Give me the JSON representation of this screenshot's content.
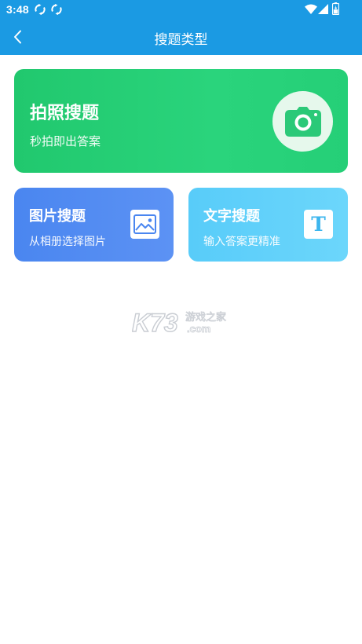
{
  "status_bar": {
    "time": "3:48"
  },
  "header": {
    "title": "搜题类型"
  },
  "cards": {
    "photo": {
      "title": "拍照搜题",
      "subtitle": "秒拍即出答案"
    },
    "image": {
      "title": "图片搜题",
      "subtitle": "从相册选择图片"
    },
    "text": {
      "title": "文字搜题",
      "subtitle": "输入答案更精准",
      "icon_glyph": "T"
    }
  },
  "watermark": {
    "brand": "K73",
    "tagline": "游戏之家",
    "domain": ".com"
  },
  "colors": {
    "header_blue": "#1b9ae3",
    "photo_card_green": "#25cf77",
    "image_card_blue": "#4a86f0",
    "text_card_cyan": "#58ccf9"
  }
}
